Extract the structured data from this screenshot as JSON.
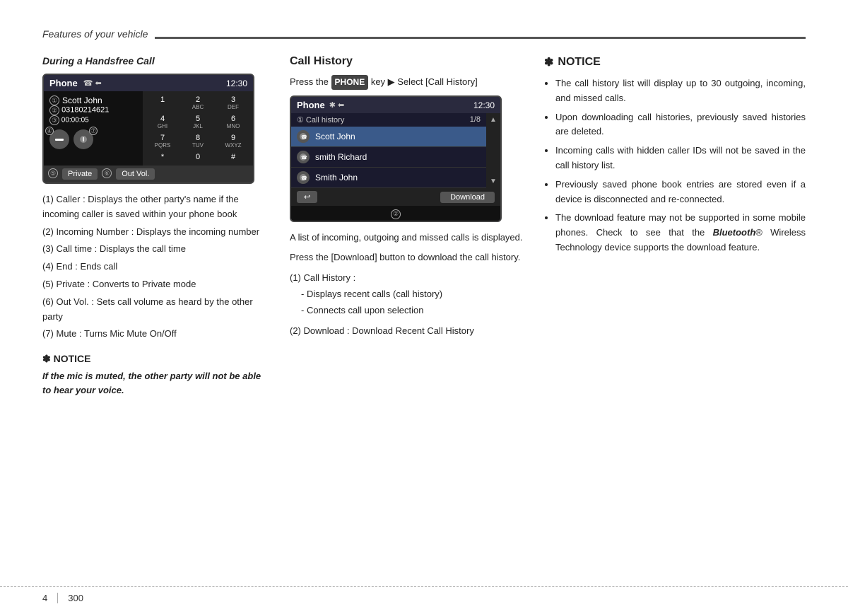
{
  "header": {
    "title": "Features of your vehicle"
  },
  "left_section": {
    "title": "During a Handsfree Call",
    "phone_screen": {
      "title": "Phone",
      "icons": [
        "☎",
        "⬅"
      ],
      "time": "12:30",
      "caller_num": "①",
      "caller_name": "Scott John",
      "number_label": "②",
      "number": "03180214621",
      "time_label": "③",
      "call_time": "00:00:05",
      "end_num": "④",
      "mute_num": "⑦",
      "keys": [
        {
          "main": "1",
          "sub": ""
        },
        {
          "main": "2",
          "sub": "ABC"
        },
        {
          "main": "3",
          "sub": "DEF"
        },
        {
          "main": "4",
          "sub": "GHI"
        },
        {
          "main": "5",
          "sub": "JKL"
        },
        {
          "main": "6",
          "sub": "MNO"
        },
        {
          "main": "7",
          "sub": "PQRS"
        },
        {
          "main": "8",
          "sub": "TUV"
        },
        {
          "main": "9",
          "sub": "WXYZ"
        },
        {
          "main": "*",
          "sub": ""
        },
        {
          "main": "0",
          "sub": ""
        },
        {
          "main": "#",
          "sub": ""
        }
      ],
      "btn_private": "Private",
      "btn_outvol": "Out Vol.",
      "btn5_num": "⑤",
      "btn6_num": "⑥"
    },
    "list": [
      "(1) Caller : Displays the other party's name if the incoming caller is saved within your phone book",
      "(2) Incoming Number : Displays the incoming number",
      "(3) Call time : Displays the call time",
      "(4) End : Ends call",
      "(5) Private : Converts to Private mode",
      "(6) Out Vol. : Sets call volume as heard by the other party",
      "(7) Mute : Turns Mic Mute On/Off"
    ],
    "notice": {
      "header": "✽ NOTICE",
      "text": "If the mic is muted, the other party will not be able to hear your voice."
    }
  },
  "middle_section": {
    "title": "Call History",
    "intro_text": "Press the",
    "phone_key": "PHONE",
    "intro_text2": "key ▶ Select [Call History]",
    "call_screen": {
      "title": "Phone",
      "icons": [
        "✱",
        "⬅"
      ],
      "time": "12:30",
      "list_label": "① Call history",
      "pagination": "1/8",
      "items": [
        {
          "name": "Scott John",
          "selected": true
        },
        {
          "name": "smith Richard",
          "selected": false
        },
        {
          "name": "Smith John",
          "selected": false
        }
      ],
      "footer_back": "↩",
      "footer_download": "Download",
      "circle2": "②"
    },
    "text1": "A list of incoming, outgoing and missed calls is displayed.",
    "text2": "Press the [Download] button to download the call history.",
    "sublist": [
      {
        "num": "(1)",
        "title": "Call History :",
        "items": [
          "- Displays recent calls (call history)",
          "- Connects call upon selection"
        ]
      },
      {
        "num": "(2)",
        "title": "Download : Download Recent Call History",
        "items": []
      }
    ]
  },
  "right_section": {
    "notice_header": "✽ NOTICE",
    "bullets": [
      "The call history list will display up to 30 outgoing, incoming, and missed calls.",
      "Upon downloading call histories, previously saved histories are deleted.",
      "Incoming calls with hidden caller IDs will not be saved in the call history list.",
      "Previously saved phone book entries are stored even if a device is disconnected and re-connected.",
      "The download feature may not be supported in some mobile phones. Check to see that the <em>Bluetooth</em>® Wireless Technology device supports the download feature."
    ]
  },
  "footer": {
    "num": "4",
    "page": "300"
  }
}
